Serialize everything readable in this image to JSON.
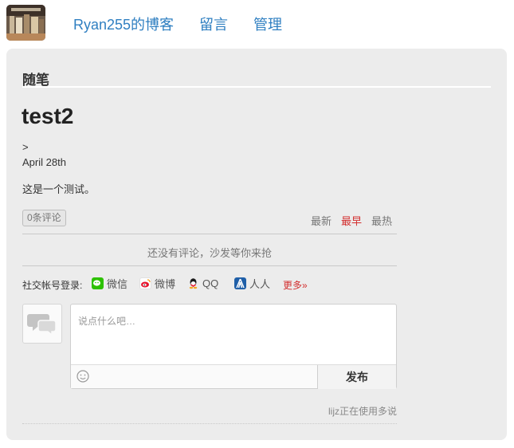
{
  "header": {
    "avatar_icon": "blog-avatar-photo",
    "nav": [
      {
        "label": "Ryan255的博客"
      },
      {
        "label": "留言"
      },
      {
        "label": "管理"
      }
    ],
    "link_color": "#2f7fc1"
  },
  "section": {
    "title": "随笔"
  },
  "post": {
    "title": "test2",
    "meta_arrow": ">",
    "date": "April 28th",
    "body": "这是一个测试。"
  },
  "comments": {
    "count_label": "0条评论",
    "sort_tabs": [
      {
        "label": "最新",
        "active": false
      },
      {
        "label": "最早",
        "active": true
      },
      {
        "label": "最热",
        "active": false
      }
    ],
    "active_color": "#d32f2f",
    "empty_message": "还没有评论，沙发等你来抢",
    "social_login_label": "社交帐号登录:",
    "social_providers": [
      {
        "label": "微信",
        "icon": "wechat-icon",
        "color": "#2dc100"
      },
      {
        "label": "微博",
        "icon": "weibo-icon",
        "color": "#e6162d"
      },
      {
        "label": "QQ",
        "icon": "qq-icon",
        "color": "#1a1a1a"
      },
      {
        "label": "人人",
        "icon": "renren-icon",
        "color": "#1f5fa8"
      }
    ],
    "more_label": "更多»",
    "reply_placeholder": "说点什么吧…",
    "submit_label": "发布",
    "powered_by": "lijz正在使用多说"
  }
}
